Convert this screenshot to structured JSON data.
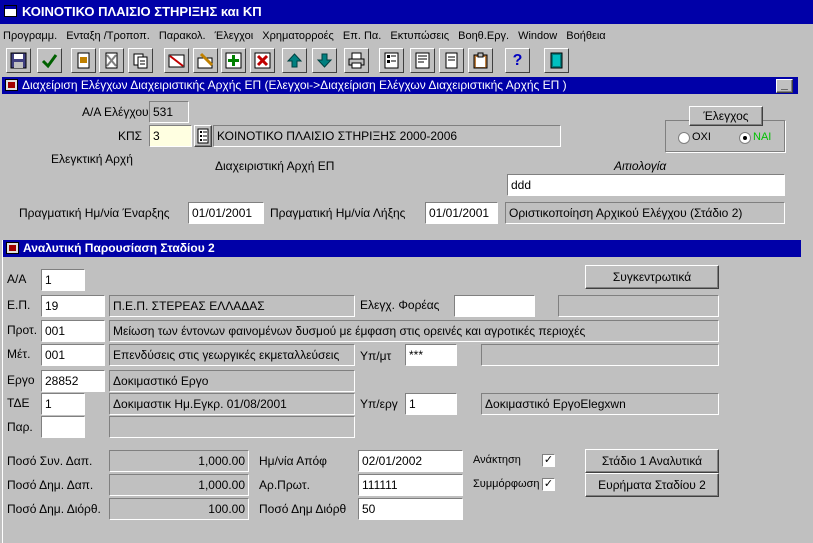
{
  "app": {
    "title": "ΚΟΙΝΟΤΙΚΟ ΠΛΑΙΣΙΟ ΣΤΗΡΙΞΗΣ και ΚΠ"
  },
  "menu": [
    "Προγραμμ.",
    "Ενταξη /Τροποπ.",
    "Παρακολ.",
    "Έλεγχοι",
    "Χρηματορροές",
    "Επ. Πα.",
    "Εκτυπώσεις",
    "Βοηθ.Εργ.",
    "Window",
    "Βοήθεια"
  ],
  "toolbar": {
    "buttons": [
      "save-icon",
      "check-icon",
      "document-icon",
      "cancel-doc-icon",
      "copy-icon",
      "clear-form-icon",
      "edit-icon",
      "add-icon",
      "delete-icon",
      "arrow-up-icon",
      "arrow-down-icon",
      "print-icon",
      "list-icon",
      "report-icon",
      "page-icon",
      "clipboard-icon",
      "help-icon",
      "exit-icon"
    ],
    "help_label": "?"
  },
  "upper": {
    "title": "Διαχείριση Ελέγχων Διαχειριστικής Αρχής ΕΠ (Ελεγχοι->Διαχείριση Ελέγχων Διαχειριστικής Αρχής ΕΠ )",
    "aa_label": "Α/Α Ελέγχου",
    "aa_value": "531",
    "kps_label": "ΚΠΣ",
    "kps_value": "3",
    "kps_desc": "ΚΟΙΝΟΤΙΚΟ ΠΛΑΙΣΙΟ ΣΤΗΡΙΞΗΣ 2000-2006",
    "audit_authority_label": "Ελεγκτική Αρχή",
    "managing_authority_label": "Διαχειριστική Αρχή ΕΠ",
    "reasoning_label": "Αιτιολογία",
    "reasoning_value": "ddd",
    "start_label": "Πραγματική Ημ/νία Έναρξης",
    "start_value": "01/01/2001",
    "end_label": "Πραγματική Ημ/νία Λήξης",
    "end_value": "01/01/2001",
    "status_value": "Οριστικοποίηση Αρχικού Ελέγχου (Στάδιο 2)",
    "check_group_label": "Έλεγχος",
    "radio_no": "ΟΧΙ",
    "radio_yes": "ΝΑΙ",
    "radio_yes_color": "#00c000",
    "minimize_label": "_"
  },
  "lower": {
    "title": "Αναλυτική Παρουσίαση Σταδίου 2",
    "aa_label": "Α/Α",
    "aa_value": "1",
    "summary_button": "Συγκεντρωτικά",
    "ep_label": "Ε.Π.",
    "ep_value": "19",
    "ep_desc": "Π.Ε.Π. ΣΤΕΡΕΑΣ ΕΛΛΑΔΑΣ",
    "body_check_label": "Ελεγχ. Φορέας",
    "body_check_value": "",
    "body_desc_value": "",
    "prot_label": "Προτ.",
    "prot_value": "001",
    "prot_desc": "Μείωση των έντονων φαινομένων δυσμού με έμφαση στις ορεινές και αγροτικές περιοχές",
    "met_label": "Μέτ.",
    "met_value": "001",
    "met_desc": "Επενδύσεις στις γεωργικές εκμεταλλεύσεις",
    "subm_label": "Υπ/μτ",
    "subm_value": "***",
    "subm_desc": "",
    "ergo_label": "Εργο",
    "ergo_value": "28852",
    "ergo_desc": "Δοκιμαστικό Εργο",
    "tde_label": "ΤΔΕ",
    "tde_value": "1",
    "tde_desc": "Δοκιμαστικ Ημ.Εγκρ. 01/08/2001",
    "suberg_label": "Υπ/εργ",
    "suberg_value": "1",
    "suberg_desc": "Δοκιμαστικό ΕργοElegxwn",
    "par_label": "Παρ.",
    "par_value": "",
    "par_desc": "",
    "amount_total_label": "Ποσό Συν. Δαπ.",
    "amount_total_value": "1,000.00",
    "amount_public_label": "Ποσό Δημ. Δαπ.",
    "amount_public_value": "1,000.00",
    "amount_corr_label": "Ποσό Δημ. Διόρθ.",
    "amount_corr_value": "100.00",
    "date_decision_label": "Ημ/νία Απόφ",
    "date_decision_value": "02/01/2002",
    "protocol_no_label": "Αρ.Πρωτ.",
    "protocol_no_value": "111111",
    "corr_amount_label": "Ποσό Δημ Διόρθ",
    "corr_amount_value": "50",
    "recovery_label": "Ανάκτηση",
    "compliance_label": "Συμμόρφωση",
    "check_mark": "✓",
    "stage1_button": "Στάδιο 1 Αναλυτικά",
    "findings_button": "Ευρήματα Σταδίου 2"
  }
}
